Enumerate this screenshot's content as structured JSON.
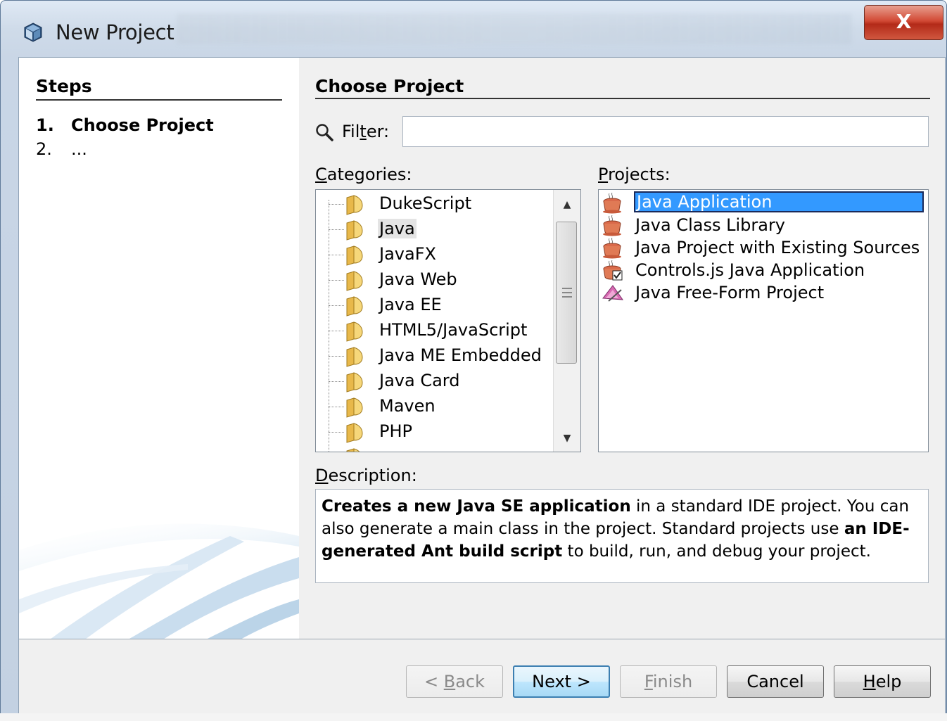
{
  "window": {
    "title": "New Project",
    "close_label": "X"
  },
  "steps": {
    "header": "Steps",
    "items": [
      {
        "num": "1.",
        "label": "Choose Project"
      },
      {
        "num": "2.",
        "label": "..."
      }
    ]
  },
  "main": {
    "heading": "Choose Project",
    "filter": {
      "label_pre": "Fil",
      "label_mn": "t",
      "label_post": "er:",
      "value": ""
    },
    "categories": {
      "label_mn": "C",
      "label_rest": "ategories:",
      "items": [
        "DukeScript",
        "Java",
        "JavaFX",
        "Java Web",
        "Java EE",
        "HTML5/JavaScript",
        "Java ME Embedded",
        "Java Card",
        "Maven",
        "PHP"
      ],
      "selected": "Java"
    },
    "projects": {
      "label_mn": "P",
      "label_rest": "rojects:",
      "items": [
        "Java Application",
        "Java Class Library",
        "Java Project with Existing Sources",
        "Controls.js Java Application",
        "Java Free-Form Project"
      ],
      "selected": "Java Application"
    },
    "description": {
      "label_mn": "D",
      "label_rest": "escription:",
      "bold1": "Creates a new Java SE application",
      "text1": " in a standard IDE project. You can also generate a main class in the project. Standard projects use ",
      "bold2": "an IDE-generated Ant build script",
      "text2": " to build, run, and debug your project."
    }
  },
  "buttons": {
    "back": {
      "pre": "< ",
      "mn": "B",
      "post": "ack"
    },
    "next": "Next >",
    "finish": {
      "mn": "F",
      "post": "inish"
    },
    "cancel": "Cancel",
    "help": {
      "mn": "H",
      "post": "elp"
    }
  },
  "colors": {
    "selection": "#3399ff",
    "close_button": "#c8412c",
    "default_button_border": "#3c7fb1"
  }
}
